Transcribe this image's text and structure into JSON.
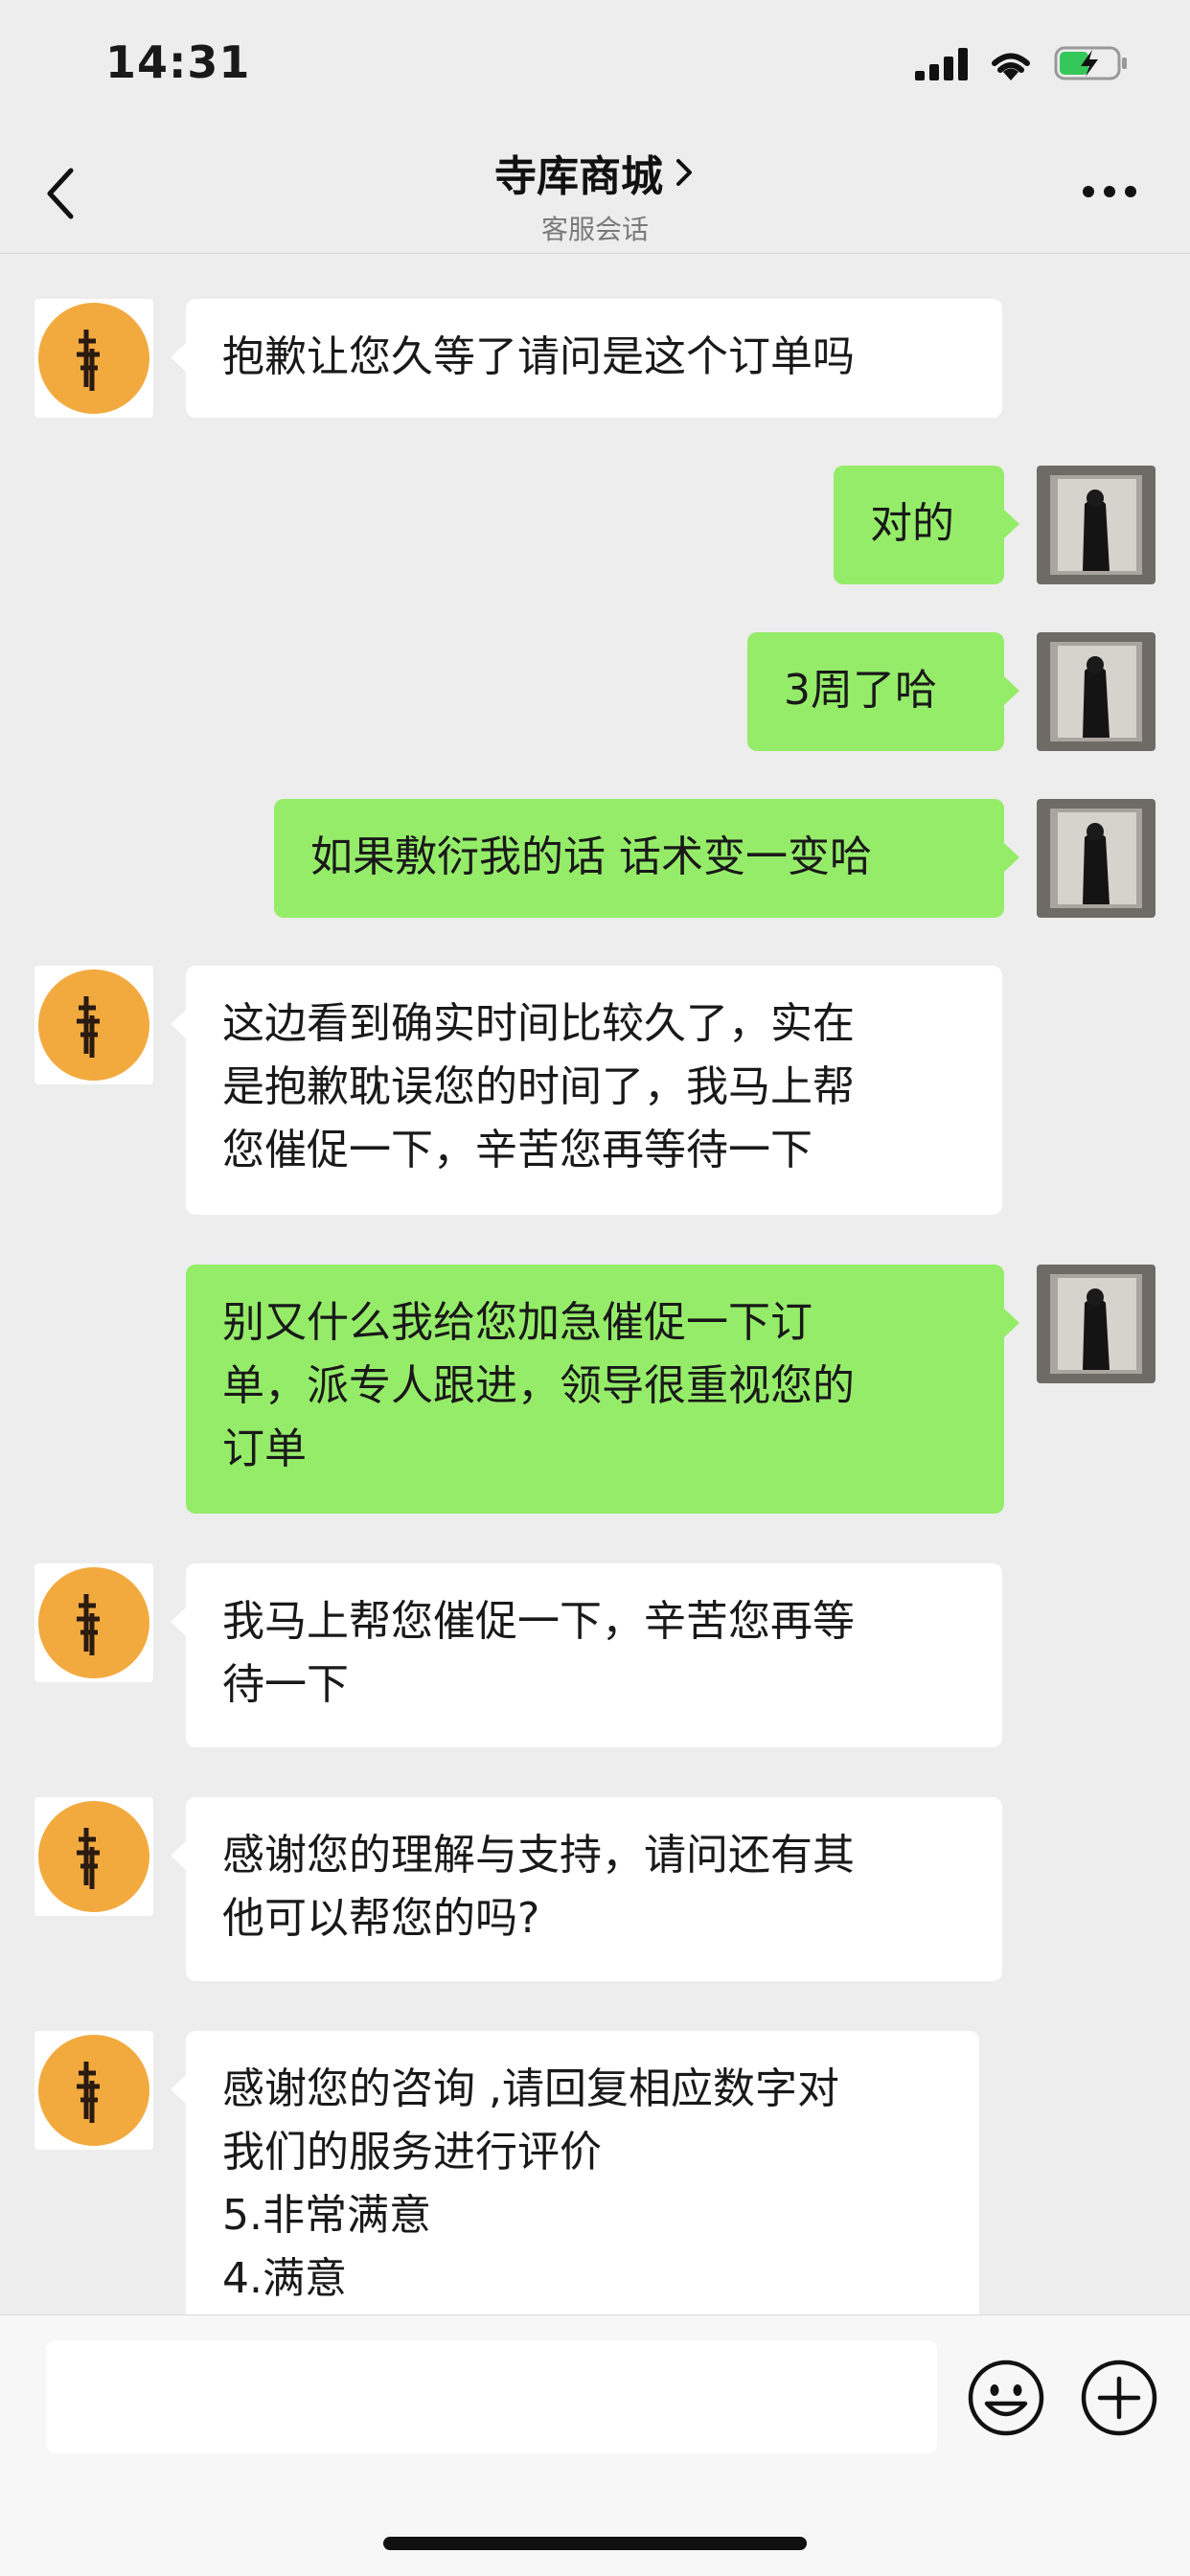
{
  "status_bar": {
    "time": "14:31"
  },
  "nav": {
    "title": "寺库商城",
    "subtitle": "客服会话"
  },
  "messages": [
    {
      "side": "in",
      "text": "抱歉让您久等了请问是这个订单吗"
    },
    {
      "side": "out",
      "text": "对的"
    },
    {
      "side": "out",
      "text": "3周了哈"
    },
    {
      "side": "out",
      "text": "如果敷衍我的话 话术变一变哈"
    },
    {
      "side": "in",
      "text": "这边看到确实时间比较久了，实在\n是抱歉耽误您的时间了，我马上帮\n您催促一下，辛苦您再等待一下"
    },
    {
      "side": "out",
      "text": "别又什么我给您加急催促一下订\n单，派专人跟进，领导很重视您的\n订单"
    },
    {
      "side": "in",
      "text": "我马上帮您催促一下，辛苦您再等\n待一下"
    },
    {
      "side": "in",
      "text": "感谢您的理解与支持，请问还有其\n他可以帮您的吗?"
    },
    {
      "side": "in",
      "text": "感谢您的咨询 ,请回复相应数字对\n我们的服务进行评价\n5.非常满意\n4.满意"
    }
  ],
  "colors": {
    "background": "#ededed",
    "bubble_out": "#95ec69",
    "bubble_in": "#ffffff",
    "logo": "#f2aa3f"
  },
  "icons": {
    "back": "chevron-left-icon",
    "more": "more-dots-icon",
    "emoji": "smiley-icon",
    "plus": "plus-circle-icon"
  }
}
